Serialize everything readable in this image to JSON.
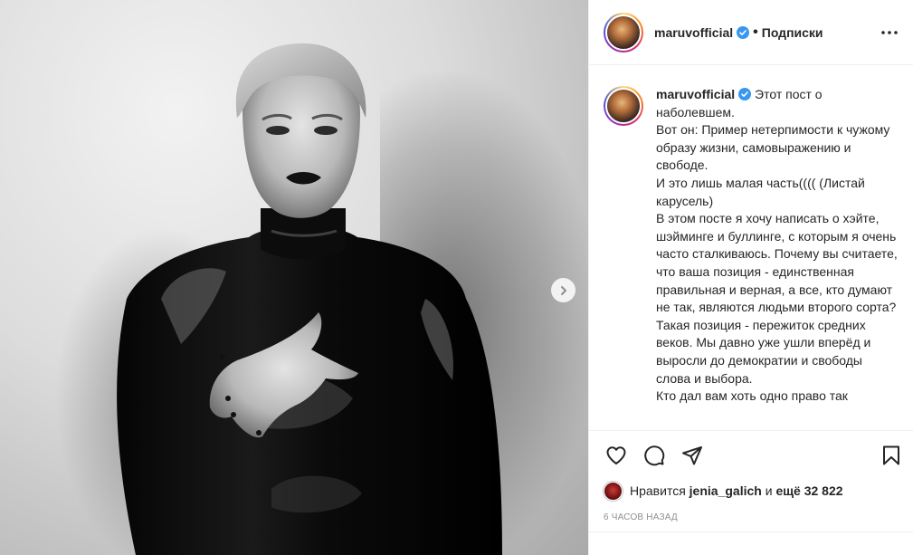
{
  "post": {
    "username": "maruvofficial",
    "separator": "•",
    "follow_status": "Подписки",
    "caption_paragraphs": [
      "Этот пост о наболевшем.",
      "Вот он: Пример нетерпимости к чужому образу жизни, самовыражению и свободе.",
      "И это лишь малая часть(((( (Листай карусель)",
      "В этом посте я хочу написать о хэйте, шэйминге и буллинге, с которым я очень часто сталкиваюсь. Почему вы считаете, что ваша позиция - единственная правильная и верная, а все, кто думают не так, являются людьми второго сорта? Такая позиция - пережиток средних веков. Мы давно уже ушли вперёд и выросли до демократии и свободы слова и выбора.",
      "Кто дал вам хоть одно право так"
    ],
    "likes": {
      "prefix": "Нравится",
      "liker": "jenia_galich",
      "conj": "и",
      "others": "ещё 32 822"
    },
    "timestamp": "6 часов назад"
  },
  "icons": {
    "verified": "verified-badge-icon",
    "more": "more-options-icon",
    "like": "heart-icon",
    "comment": "comment-icon",
    "share": "share-icon",
    "save": "bookmark-icon",
    "next": "chevron-right-icon"
  },
  "colors": {
    "verified": "#3897f0",
    "text": "#262626",
    "muted": "#8e8e8e",
    "divider": "#efefef"
  }
}
